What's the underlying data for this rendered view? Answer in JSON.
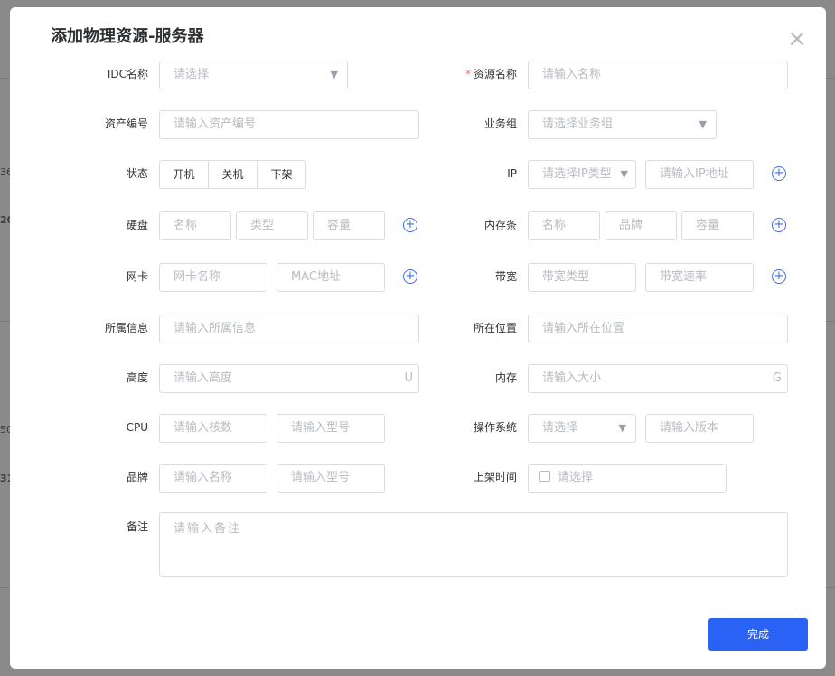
{
  "dialog": {
    "title": "添加物理资源-服务器",
    "close": "×",
    "submit_label": "完成"
  },
  "background": {
    "frag1": "36.",
    "frag2": "20",
    "frag3": "50(",
    "frag4": "31("
  },
  "fields": {
    "idc": {
      "label": "IDC名称",
      "placeholder": "请选择"
    },
    "resource_name": {
      "required_mark": "*",
      "label": "资源名称",
      "placeholder": "请输入名称"
    },
    "asset_no": {
      "label": "资产编号",
      "placeholder": "请输入资产编号"
    },
    "business_group": {
      "label": "业务组",
      "placeholder": "请选择业务组"
    },
    "status": {
      "label": "状态",
      "options": [
        "开机",
        "关机",
        "下架"
      ]
    },
    "ip": {
      "label": "IP",
      "type_placeholder": "请选择IP类型",
      "addr_placeholder": "请输入IP地址"
    },
    "disk": {
      "label": "硬盘",
      "name": "名称",
      "type": "类型",
      "capacity": "容量"
    },
    "memory_stick": {
      "label": "内存条",
      "name": "名称",
      "brand": "品牌",
      "capacity": "容量"
    },
    "nic": {
      "label": "网卡",
      "name": "网卡名称",
      "mac": "MAC地址"
    },
    "bandwidth": {
      "label": "带宽",
      "type": "带宽类型",
      "rate": "带宽速率"
    },
    "ownership": {
      "label": "所属信息",
      "placeholder": "请输入所属信息"
    },
    "location": {
      "label": "所在位置",
      "placeholder": "请输入所在位置"
    },
    "height": {
      "label": "高度",
      "placeholder": "请输入高度",
      "suffix": "U"
    },
    "memory": {
      "label": "内存",
      "placeholder": "请输入大小",
      "suffix": "G"
    },
    "cpu": {
      "label": "CPU",
      "cores": "请输入核数",
      "model": "请输入型号"
    },
    "os": {
      "label": "操作系统",
      "placeholder": "请选择",
      "version": "请输入版本"
    },
    "brand": {
      "label": "品牌",
      "name": "请输入名称",
      "model": "请输入型号"
    },
    "shelf_time": {
      "label": "上架时间",
      "placeholder": "请选择"
    },
    "remark": {
      "label": "备注",
      "placeholder": "请输入备注"
    }
  },
  "icons": {
    "plus": "+",
    "arrow": "▼"
  }
}
